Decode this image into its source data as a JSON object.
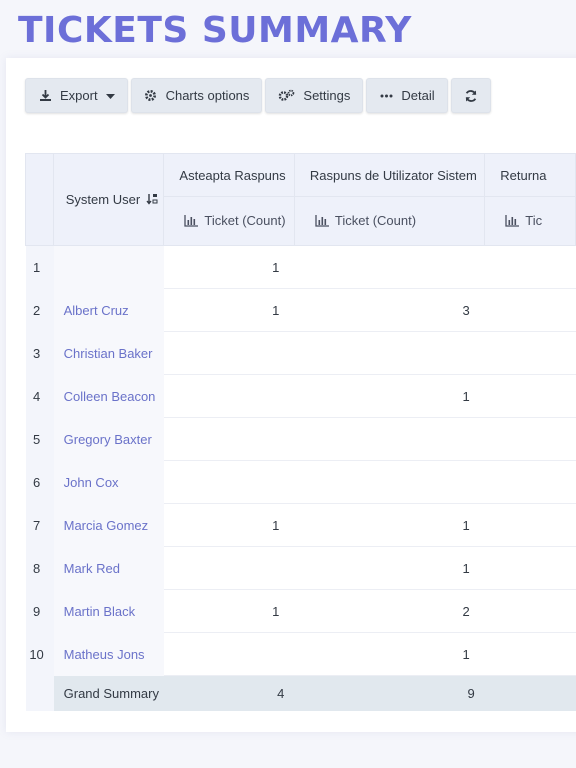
{
  "page": {
    "title": "TICKETS SUMMARY"
  },
  "toolbar": {
    "export_label": "Export",
    "charts_label": "Charts options",
    "settings_label": "Settings",
    "detail_label": "Detail"
  },
  "table": {
    "row_header": "System User",
    "columns": [
      {
        "label": "Asteapta Raspuns",
        "measure": "Ticket (Count)"
      },
      {
        "label": "Raspuns de Utilizator Sistem",
        "measure": "Ticket (Count)"
      },
      {
        "label": "Returna",
        "measure": "Tic"
      }
    ],
    "rows": [
      {
        "idx": "1",
        "name": "",
        "v1": "1",
        "v2": "",
        "v3": ""
      },
      {
        "idx": "2",
        "name": "Albert Cruz",
        "v1": "1",
        "v2": "3",
        "v3": ""
      },
      {
        "idx": "3",
        "name": "Christian Baker",
        "v1": "",
        "v2": "",
        "v3": ""
      },
      {
        "idx": "4",
        "name": "Colleen Beacon",
        "v1": "",
        "v2": "1",
        "v3": ""
      },
      {
        "idx": "5",
        "name": "Gregory Baxter",
        "v1": "",
        "v2": "",
        "v3": ""
      },
      {
        "idx": "6",
        "name": "John Cox",
        "v1": "",
        "v2": "",
        "v3": ""
      },
      {
        "idx": "7",
        "name": "Marcia Gomez",
        "v1": "1",
        "v2": "1",
        "v3": ""
      },
      {
        "idx": "8",
        "name": "Mark Red",
        "v1": "",
        "v2": "1",
        "v3": ""
      },
      {
        "idx": "9",
        "name": "Martin Black",
        "v1": "1",
        "v2": "2",
        "v3": ""
      },
      {
        "idx": "10",
        "name": "Matheus Jons",
        "v1": "",
        "v2": "1",
        "v3": ""
      }
    ],
    "summary": {
      "label": "Grand Summary",
      "v1": "4",
      "v2": "9",
      "v3": ""
    }
  },
  "icons": {
    "export": "download-icon",
    "charts": "gear-icon",
    "settings": "gears-icon",
    "detail": "ellipsis-icon",
    "refresh": "refresh-icon",
    "sort": "sort-icon",
    "measure": "bar-chart-icon"
  },
  "colors": {
    "title": "#6c6fd8",
    "link": "#6a72c9",
    "toolbar_bg": "#e4e9f0",
    "summary_bg": "#e1e8ee"
  }
}
